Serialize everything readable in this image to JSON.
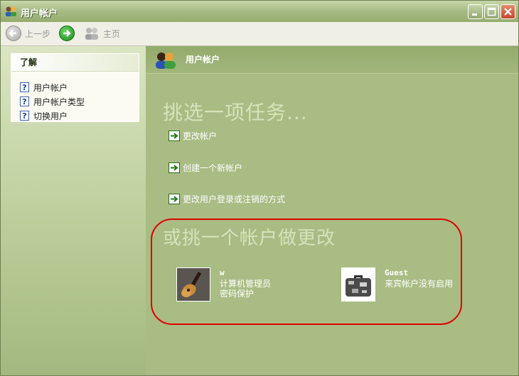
{
  "window": {
    "title": "用户帐户",
    "title_icon": "users-icon"
  },
  "toolbar": {
    "back_label": "上一步",
    "forward_icon": "forward-arrow-icon",
    "home_label": "主页"
  },
  "sidebar": {
    "header": "了解",
    "items": [
      {
        "label": "用户帐户",
        "icon": "help-icon"
      },
      {
        "label": "用户帐户类型",
        "icon": "help-icon"
      },
      {
        "label": "切换用户",
        "icon": "help-icon"
      }
    ]
  },
  "main": {
    "header_title": "用户帐户",
    "task_heading": "挑选一项任务...",
    "tasks": [
      {
        "label": "更改帐户"
      },
      {
        "label": "创建一个新帐户"
      },
      {
        "label": "更改用户登录或注销的方式"
      }
    ],
    "accounts_heading": "或挑一个帐户做更改",
    "accounts": [
      {
        "name": "w",
        "line1": "计算机管理员",
        "line2": "密码保护",
        "picture": "guitar-picture"
      },
      {
        "name": "Guest",
        "line1": "来宾帐户没有启用",
        "line2": "",
        "picture": "suitcase-picture"
      }
    ]
  },
  "colors": {
    "highlight_outline": "#e10000",
    "pane_green": "#a9bc84"
  }
}
